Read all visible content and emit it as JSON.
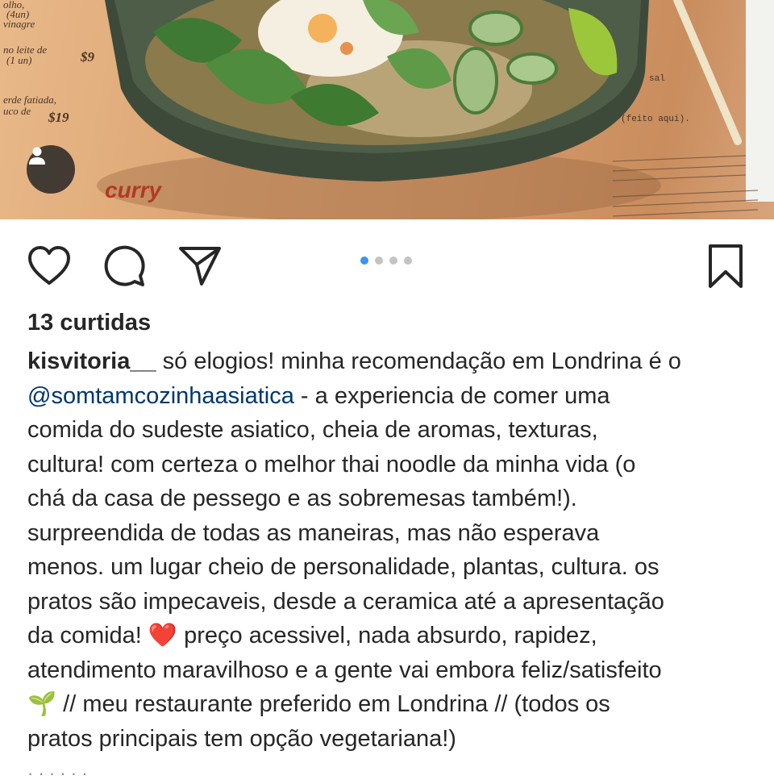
{
  "post": {
    "likes_text": "13 curtidas",
    "username": "kisvitoria__",
    "mention": "@somtamcozinhaasiatica",
    "caption_first": " só elogios! minha recomendação em Londrina é o",
    "caption_after_mention": " - a experiencia de comer uma",
    "caption_lines": [
      "comida do sudeste asiatico, cheia de aromas, texturas,",
      "cultura! com certeza o melhor thai noodle da minha vida (o",
      "chá da casa de pessego e as sobremesas também!).",
      "surpreendida de todas as maneiras, mas não esperava",
      "menos. um lugar cheio de personalidade, plantas, cultura. os",
      "pratos são impecaveis, desde a ceramica até a apresentação"
    ],
    "caption_heart_before": "da comida! ",
    "heart_emoji": "❤️",
    "caption_heart_after": " preço acessivel, nada absurdo, rapidez,",
    "caption_line_10": "atendimento maravilhoso e a gente vai embora feliz/satisfeito",
    "seedling_emoji": "🌱",
    "caption_line_11": " // meu restaurante preferido em Londrina // (todos os",
    "caption_line_12": "pratos principais tem opção vegetariana!)",
    "cut_off_text": "· · · · · ·"
  },
  "carousel": {
    "count": 4,
    "active_index": 0
  },
  "photo_menu_text": {
    "price_1": "$9",
    "price_2": "$19",
    "item_a": "olho,",
    "item_b": "(4un)",
    "item_c": "vinagre",
    "item_d": "no leite de",
    "item_e": "(1 un)",
    "item_f": "erde fatiada,",
    "item_g": "uco de",
    "feito": "(feito aqui).",
    "brand": "curry",
    "sal": "sal"
  },
  "icons": {
    "like": "heart-outline-icon",
    "comment": "comment-bubble-icon",
    "share": "paper-plane-icon",
    "save": "bookmark-icon",
    "user": "user-silhouette-icon"
  },
  "colors": {
    "text": "#262626",
    "mention": "#00376b",
    "dot_active": "#3897f0",
    "dot_inactive": "#c4c4c4"
  }
}
